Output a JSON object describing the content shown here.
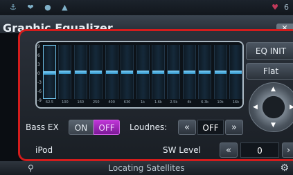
{
  "status": {
    "icons": "⚓ ❤ ● ▲",
    "right": "6"
  },
  "title": "Graphic Equalizer",
  "eq": {
    "y_ticks": [
      "9",
      "6",
      "3",
      "0",
      "-3",
      "-6",
      "-9"
    ],
    "bands": [
      "62.5",
      "100",
      "160",
      "250",
      "400",
      "630",
      "1k",
      "1.6k",
      "2.5k",
      "4k",
      "6.3k",
      "10k",
      "16k"
    ],
    "levels": [
      0,
      0,
      0,
      0,
      0,
      0,
      0,
      0,
      0,
      0,
      0,
      0,
      0
    ],
    "selected_band": 0
  },
  "buttons": {
    "eq_init": "EQ INIT",
    "flat": "Flat"
  },
  "bass_ex": {
    "label": "Bass EX",
    "on": "ON",
    "off": "OFF"
  },
  "loudness": {
    "label": "Loudnes:",
    "left": "«",
    "value": "OFF",
    "right": "»"
  },
  "source": {
    "label": "iPod"
  },
  "sw_level": {
    "label": "SW Level",
    "left": "«",
    "value": "0",
    "right": "›"
  },
  "bottom": {
    "status_text": "Locating Satellites"
  },
  "colors": {
    "accent_border": "#d41c1c",
    "off_active": "#b030d0",
    "eq_knob": "#4fb4e8"
  }
}
